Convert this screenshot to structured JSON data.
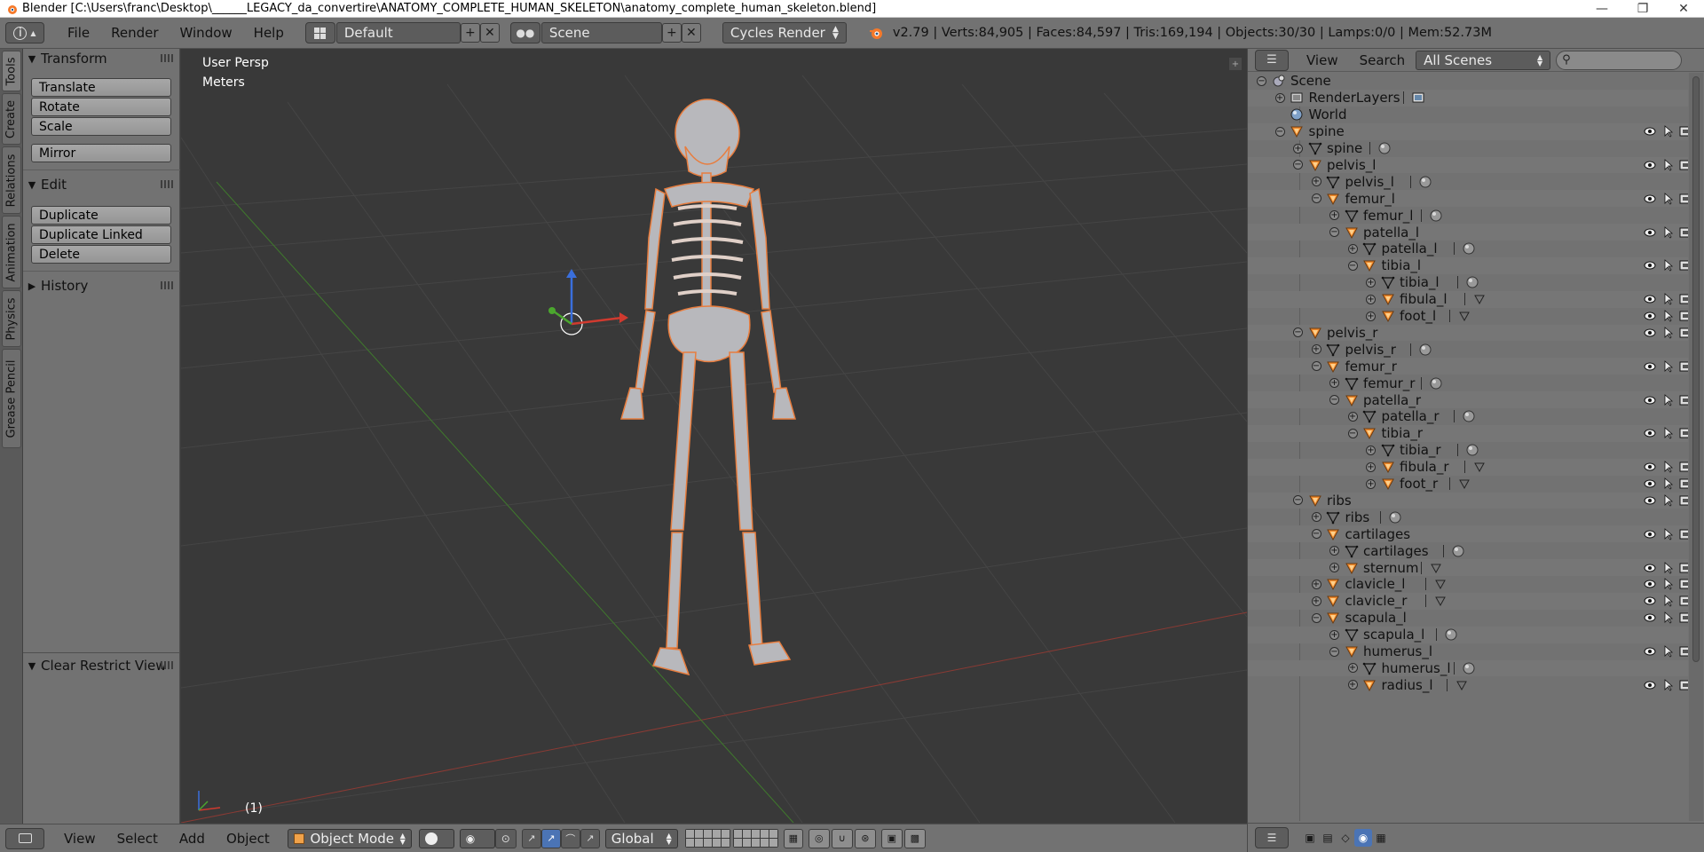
{
  "window": {
    "title": "Blender [C:\\Users\\franc\\Desktop\\______LEGACY_da_convertire\\ANATOMY_COMPLETE_HUMAN_SKELETON\\anatomy_complete_human_skeleton.blend]"
  },
  "topbar": {
    "menus": [
      "File",
      "Render",
      "Window",
      "Help"
    ],
    "screen_layout": "Default",
    "scene": "Scene",
    "render_engine": "Cycles Render",
    "stats": "v2.79 | Verts:84,905 | Faces:84,597 | Tris:169,194 | Objects:30/30 | Lamps:0/0 | Mem:52.73M"
  },
  "tool_tabs": [
    "Tools",
    "Create",
    "Relations",
    "Animation",
    "Physics",
    "Grease Pencil"
  ],
  "tool_shelf": {
    "transform": {
      "title": "Transform",
      "buttons": [
        "Translate",
        "Rotate",
        "Scale",
        "Mirror"
      ]
    },
    "edit": {
      "title": "Edit",
      "buttons": [
        "Duplicate",
        "Duplicate Linked",
        "Delete"
      ]
    },
    "history": {
      "title": "History"
    },
    "operator": {
      "title": "Clear Restrict View"
    }
  },
  "viewport": {
    "view_name": "User Persp",
    "units": "Meters",
    "frame": "(1)"
  },
  "bottombar": {
    "menus": [
      "View",
      "Select",
      "Add",
      "Object"
    ],
    "mode": "Object Mode",
    "orientation": "Global"
  },
  "outliner": {
    "menus": [
      "View",
      "Search"
    ],
    "display_mode": "All Scenes",
    "search_value": "",
    "rows": [
      {
        "label": "Scene",
        "depth": 0,
        "type": "scene",
        "expand": "minus",
        "restrict": false
      },
      {
        "label": "RenderLayers",
        "depth": 1,
        "type": "renderlayers",
        "expand": "plus",
        "restrict": false,
        "extra": "renderlayer"
      },
      {
        "label": "World",
        "depth": 1,
        "type": "world",
        "expand": "",
        "restrict": false
      },
      {
        "label": "spine",
        "depth": 1,
        "type": "object",
        "expand": "minus",
        "restrict": true
      },
      {
        "label": "spine",
        "depth": 2,
        "type": "mesh",
        "expand": "plus",
        "restrict": false,
        "extra": "material"
      },
      {
        "label": "pelvis_l",
        "depth": 2,
        "type": "object",
        "expand": "minus",
        "restrict": true
      },
      {
        "label": "pelvis_l",
        "depth": 3,
        "type": "mesh",
        "expand": "plus",
        "restrict": false,
        "extra": "material"
      },
      {
        "label": "femur_l",
        "depth": 3,
        "type": "object",
        "expand": "minus",
        "restrict": true
      },
      {
        "label": "femur_l",
        "depth": 4,
        "type": "mesh",
        "expand": "plus",
        "restrict": false,
        "extra": "material"
      },
      {
        "label": "patella_l",
        "depth": 4,
        "type": "object",
        "expand": "minus",
        "restrict": true
      },
      {
        "label": "patella_l",
        "depth": 5,
        "type": "mesh",
        "expand": "plus",
        "restrict": false,
        "extra": "material"
      },
      {
        "label": "tibia_l",
        "depth": 5,
        "type": "object",
        "expand": "minus",
        "restrict": true
      },
      {
        "label": "tibia_l",
        "depth": 6,
        "type": "mesh",
        "expand": "plus",
        "restrict": false,
        "extra": "material"
      },
      {
        "label": "fibula_l",
        "depth": 6,
        "type": "object",
        "expand": "plus",
        "restrict": true,
        "extra": "mesh"
      },
      {
        "label": "foot_l",
        "depth": 6,
        "type": "object",
        "expand": "plus",
        "restrict": true,
        "extra": "mesh"
      },
      {
        "label": "pelvis_r",
        "depth": 2,
        "type": "object",
        "expand": "minus",
        "restrict": true
      },
      {
        "label": "pelvis_r",
        "depth": 3,
        "type": "mesh",
        "expand": "plus",
        "restrict": false,
        "extra": "material"
      },
      {
        "label": "femur_r",
        "depth": 3,
        "type": "object",
        "expand": "minus",
        "restrict": true
      },
      {
        "label": "femur_r",
        "depth": 4,
        "type": "mesh",
        "expand": "plus",
        "restrict": false,
        "extra": "material"
      },
      {
        "label": "patella_r",
        "depth": 4,
        "type": "object",
        "expand": "minus",
        "restrict": true
      },
      {
        "label": "patella_r",
        "depth": 5,
        "type": "mesh",
        "expand": "plus",
        "restrict": false,
        "extra": "material"
      },
      {
        "label": "tibia_r",
        "depth": 5,
        "type": "object",
        "expand": "minus",
        "restrict": true
      },
      {
        "label": "tibia_r",
        "depth": 6,
        "type": "mesh",
        "expand": "plus",
        "restrict": false,
        "extra": "material"
      },
      {
        "label": "fibula_r",
        "depth": 6,
        "type": "object",
        "expand": "plus",
        "restrict": true,
        "extra": "mesh"
      },
      {
        "label": "foot_r",
        "depth": 6,
        "type": "object",
        "expand": "plus",
        "restrict": true,
        "extra": "mesh"
      },
      {
        "label": "ribs",
        "depth": 2,
        "type": "object",
        "expand": "minus",
        "restrict": true
      },
      {
        "label": "ribs",
        "depth": 3,
        "type": "mesh",
        "expand": "plus",
        "restrict": false,
        "extra": "material"
      },
      {
        "label": "cartilages",
        "depth": 3,
        "type": "object",
        "expand": "minus",
        "restrict": true
      },
      {
        "label": "cartilages",
        "depth": 4,
        "type": "mesh",
        "expand": "plus",
        "restrict": false,
        "extra": "material"
      },
      {
        "label": "sternum",
        "depth": 4,
        "type": "object",
        "expand": "plus",
        "restrict": true,
        "extra": "mesh"
      },
      {
        "label": "clavicle_l",
        "depth": 3,
        "type": "object",
        "expand": "plus",
        "restrict": true,
        "extra": "mesh"
      },
      {
        "label": "clavicle_r",
        "depth": 3,
        "type": "object",
        "expand": "plus",
        "restrict": true,
        "extra": "mesh"
      },
      {
        "label": "scapula_l",
        "depth": 3,
        "type": "object",
        "expand": "minus",
        "restrict": true
      },
      {
        "label": "scapula_l",
        "depth": 4,
        "type": "mesh",
        "expand": "plus",
        "restrict": false,
        "extra": "material"
      },
      {
        "label": "humerus_l",
        "depth": 4,
        "type": "object",
        "expand": "minus",
        "restrict": true
      },
      {
        "label": "humerus_l",
        "depth": 5,
        "type": "mesh",
        "expand": "plus",
        "restrict": false,
        "extra": "material"
      },
      {
        "label": "radius_l",
        "depth": 5,
        "type": "object",
        "expand": "plus",
        "restrict": true,
        "extra": "mesh"
      }
    ]
  },
  "colors": {
    "panel_bg": "#727272",
    "viewport_bg": "#393939",
    "selection_outline": "#e87d3e",
    "object_icon": "#f08a2c",
    "axis_x": "#c8453a",
    "axis_y": "#4b9c2c"
  }
}
